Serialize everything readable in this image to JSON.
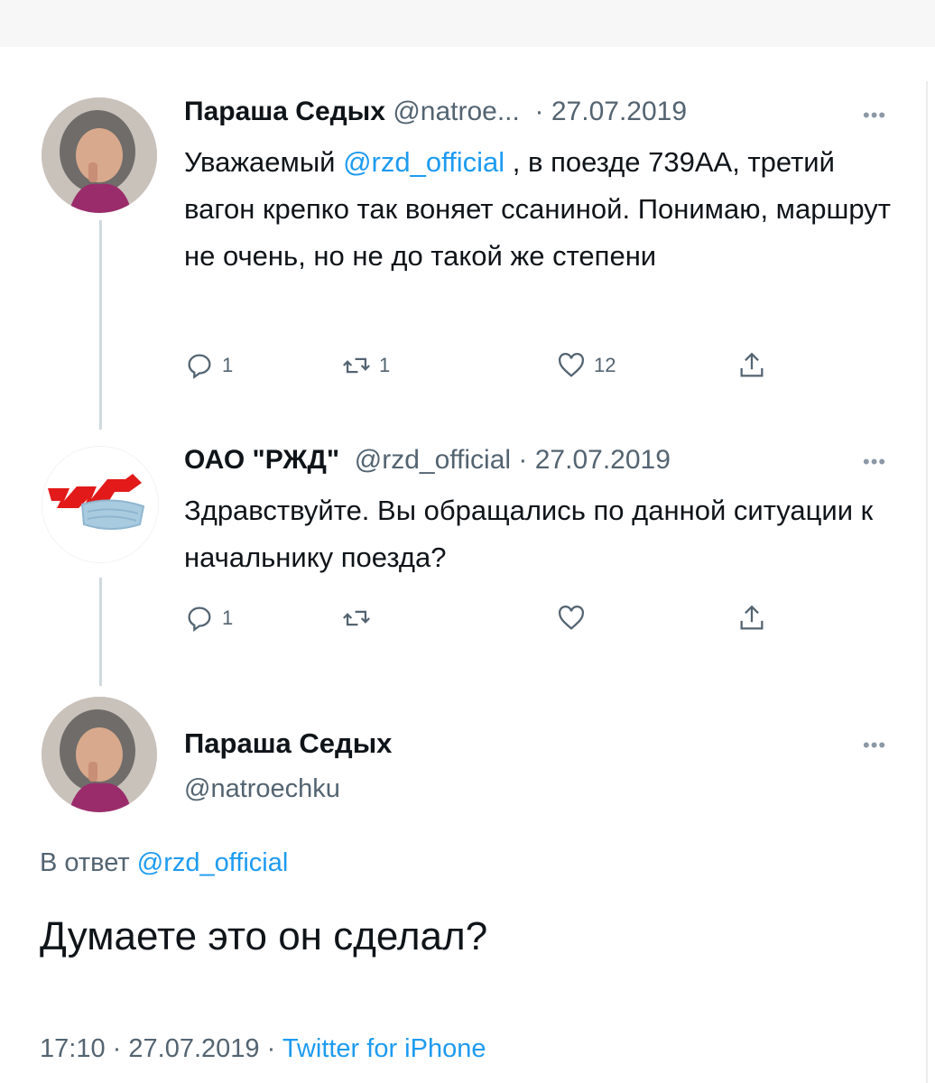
{
  "tweets": [
    {
      "author_name": "Параша Седых",
      "author_handle": "@natroe...",
      "separator": "·",
      "date": "27.07.2019",
      "text_before": "Уважаемый ",
      "mention": "@rzd_official",
      "text_after": " , в поезде 739АА, третий вагон крепко так воняет ссаниной. Понимаю, маршрут не очень, но не до такой же степени",
      "reply_count": "1",
      "retweet_count": "1",
      "like_count": "12"
    },
    {
      "author_name": "ОАО \"РЖД\"",
      "author_handle": "@rzd_official",
      "separator": "·",
      "date": "27.07.2019",
      "text": "Здравствуйте. Вы обращались по данной ситуации к начальнику поезда?",
      "reply_count": "1"
    }
  ],
  "main_tweet": {
    "author_name": "Параша Седых",
    "author_handle": "@natroechku",
    "reply_prefix": "В ответ",
    "reply_mention": "@rzd_official",
    "text": "Думаете это он сделал?",
    "time": "17:10",
    "separator": "·",
    "date": "27.07.2019",
    "client": "Twitter for iPhone"
  },
  "icons": {
    "more": "more-horizontal-icon",
    "reply": "reply-icon",
    "retweet": "retweet-icon",
    "like": "heart-icon",
    "share": "share-icon"
  },
  "colors": {
    "link": "#1d9bf0",
    "secondary_text": "#536471",
    "thread_line": "#cfd9de",
    "rzd_logo": "#e21a1a",
    "mask": "#a9cbe0"
  }
}
